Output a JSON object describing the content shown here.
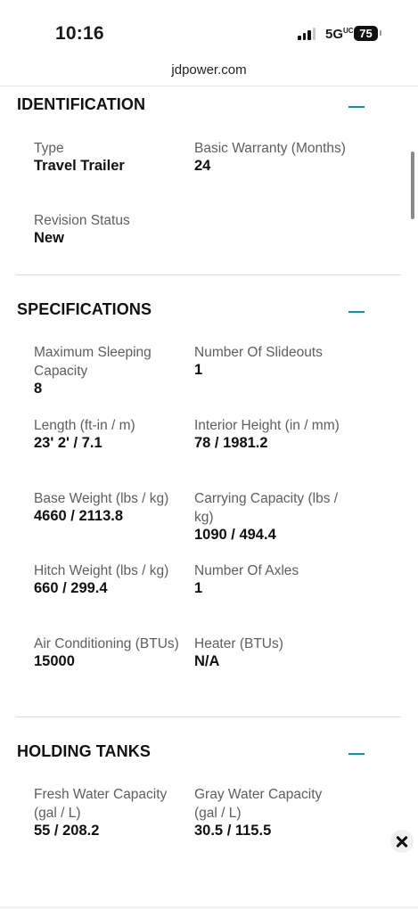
{
  "status_bar": {
    "time": "10:16",
    "network": "5G",
    "network_suffix": "UC",
    "battery": "75"
  },
  "browser": {
    "url": "jdpower.com"
  },
  "identification": {
    "title": "IDENTIFICATION",
    "fields": [
      {
        "label": "Type",
        "value": "Travel Trailer"
      },
      {
        "label": "Basic Warranty (Months)",
        "value": "24"
      },
      {
        "label": "Revision Status",
        "value": "New"
      }
    ]
  },
  "specifications": {
    "title": "SPECIFICATIONS",
    "fields": [
      {
        "label": "Maximum Sleeping Capacity",
        "value": "8"
      },
      {
        "label": "Number Of Slideouts",
        "value": "1"
      },
      {
        "label": "Length (ft-in / m)",
        "value": "23' 2' / 7.1"
      },
      {
        "label": "Interior Height (in / mm)",
        "value": "78 / 1981.2"
      },
      {
        "label": "Base Weight (lbs / kg)",
        "value": "4660 / 2113.8"
      },
      {
        "label": "Carrying Capacity (lbs / kg)",
        "value": "1090 / 494.4"
      },
      {
        "label": "Hitch Weight (lbs / kg)",
        "value": "660 / 299.4"
      },
      {
        "label": "Number Of Axles",
        "value": "1"
      },
      {
        "label": "Air Conditioning (BTUs)",
        "value": "15000"
      },
      {
        "label": "Heater (BTUs)",
        "value": "N/A"
      }
    ]
  },
  "holding_tanks": {
    "title": "HOLDING TANKS",
    "fields": [
      {
        "label": "Fresh Water Capacity (gal / L)",
        "value": "55 / 208.2"
      },
      {
        "label": "Gray Water Capacity (gal / L)",
        "value": "30.5 / 115.5"
      }
    ]
  },
  "icons": {
    "collapse": "minus-icon",
    "close": "close-icon"
  },
  "colors": {
    "accent": "#1a8f99"
  }
}
